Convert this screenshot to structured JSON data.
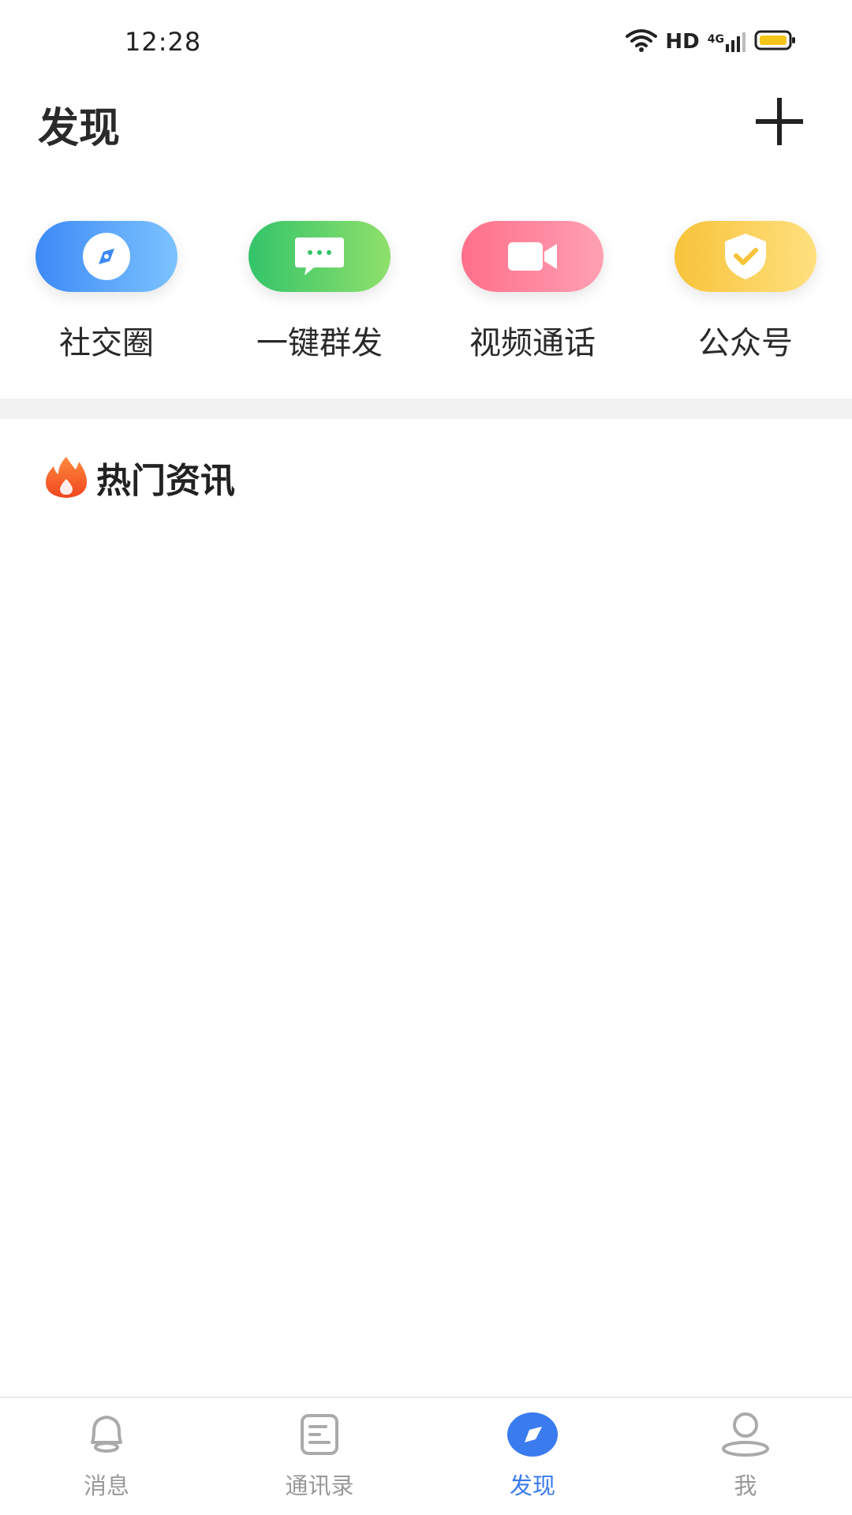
{
  "status_bar": {
    "time": "12:28",
    "network_label": "HD",
    "signal_label": "4G",
    "wifi_icon": "wifi-icon",
    "battery_color": "#f5c518"
  },
  "header": {
    "title": "发现",
    "add_icon": "plus-icon"
  },
  "quick_actions": [
    {
      "label": "社交圈",
      "icon": "compass-icon",
      "color_from": "#3d8af7",
      "color_to": "#7cc3ff"
    },
    {
      "label": "一键群发",
      "icon": "chat-bubble-icon",
      "color_from": "#34c46a",
      "color_to": "#8fe06b"
    },
    {
      "label": "视频通话",
      "icon": "video-camera-icon",
      "color_from": "#ff6f8a",
      "color_to": "#ffa0b3"
    },
    {
      "label": "公众号",
      "icon": "shield-check-icon",
      "color_from": "#f7c33a",
      "color_to": "#ffe07f"
    }
  ],
  "hot_news": {
    "title": "热门资讯",
    "icon": "fire-icon"
  },
  "tab_bar": {
    "tabs": [
      {
        "label": "消息",
        "icon": "bell-icon",
        "active": false
      },
      {
        "label": "通讯录",
        "icon": "contacts-icon",
        "active": false
      },
      {
        "label": "发现",
        "icon": "compass-icon",
        "active": true
      },
      {
        "label": "我",
        "icon": "user-icon",
        "active": false
      }
    ],
    "active_color": "#3a7bef",
    "inactive_color": "#999999"
  }
}
